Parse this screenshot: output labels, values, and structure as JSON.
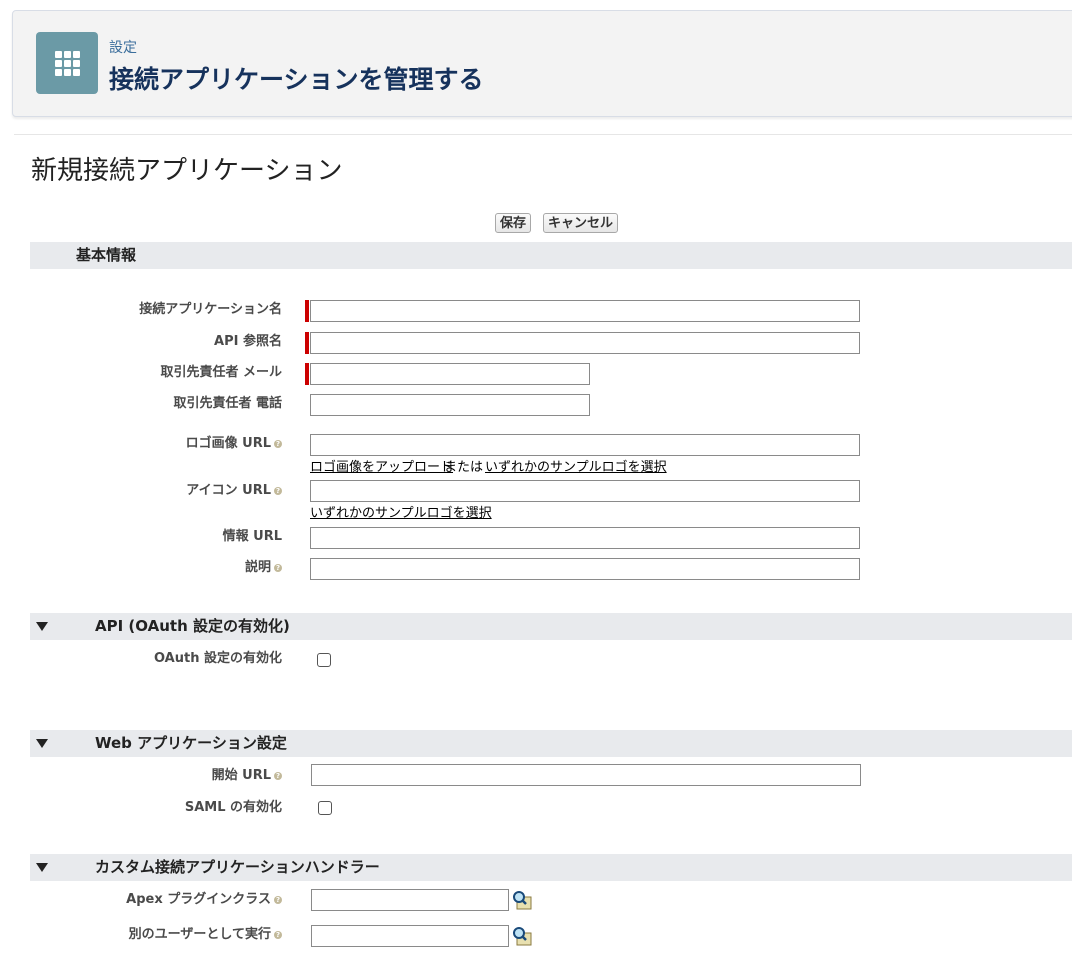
{
  "header": {
    "breadcrumb": "設定",
    "title": "接続アプリケーションを管理する",
    "icon": "app-grid-icon",
    "icon_color": "#6b9aa6"
  },
  "page_title": "新規接続アプリケーション",
  "buttons": {
    "save": "保存",
    "cancel": "キャンセル"
  },
  "sections": {
    "basic": {
      "title": "基本情報"
    },
    "api": {
      "title": "API (OAuth 設定の有効化)"
    },
    "web": {
      "title": "Web アプリケーション設定"
    },
    "handler": {
      "title": "カスタム接続アプリケーションハンドラー"
    }
  },
  "fields": {
    "app_name": {
      "label": "接続アプリケーション名",
      "value": "",
      "required": true
    },
    "api_name": {
      "label": "API 参照名",
      "value": "",
      "required": true
    },
    "contact_email": {
      "label": "取引先責任者 メール",
      "value": "",
      "required": true
    },
    "contact_phone": {
      "label": "取引先責任者 電話",
      "value": ""
    },
    "logo_url": {
      "label": "ロゴ画像 URL",
      "value": ""
    },
    "icon_url": {
      "label": "アイコン URL",
      "value": ""
    },
    "info_url": {
      "label": "情報 URL",
      "value": ""
    },
    "description": {
      "label": "説明",
      "value": ""
    },
    "oauth_enable": {
      "label": "OAuth 設定の有効化",
      "checked": false
    },
    "start_url": {
      "label": "開始 URL",
      "value": ""
    },
    "saml_enable": {
      "label": "SAML の有効化",
      "checked": false
    },
    "apex_plugin": {
      "label": "Apex プラグインクラス",
      "value": ""
    },
    "run_as": {
      "label": "別のユーザーとして実行",
      "value": ""
    }
  },
  "links": {
    "upload_logo": "ロゴ画像をアップロード",
    "or_text": "または",
    "choose_sample_logo": "いずれかのサンプルロゴを選択",
    "choose_sample_icon": "いずれかのサンプルロゴを選択"
  },
  "colors": {
    "required": "#cc0000",
    "section_bg": "#e8eaed",
    "title": "#16325c"
  }
}
